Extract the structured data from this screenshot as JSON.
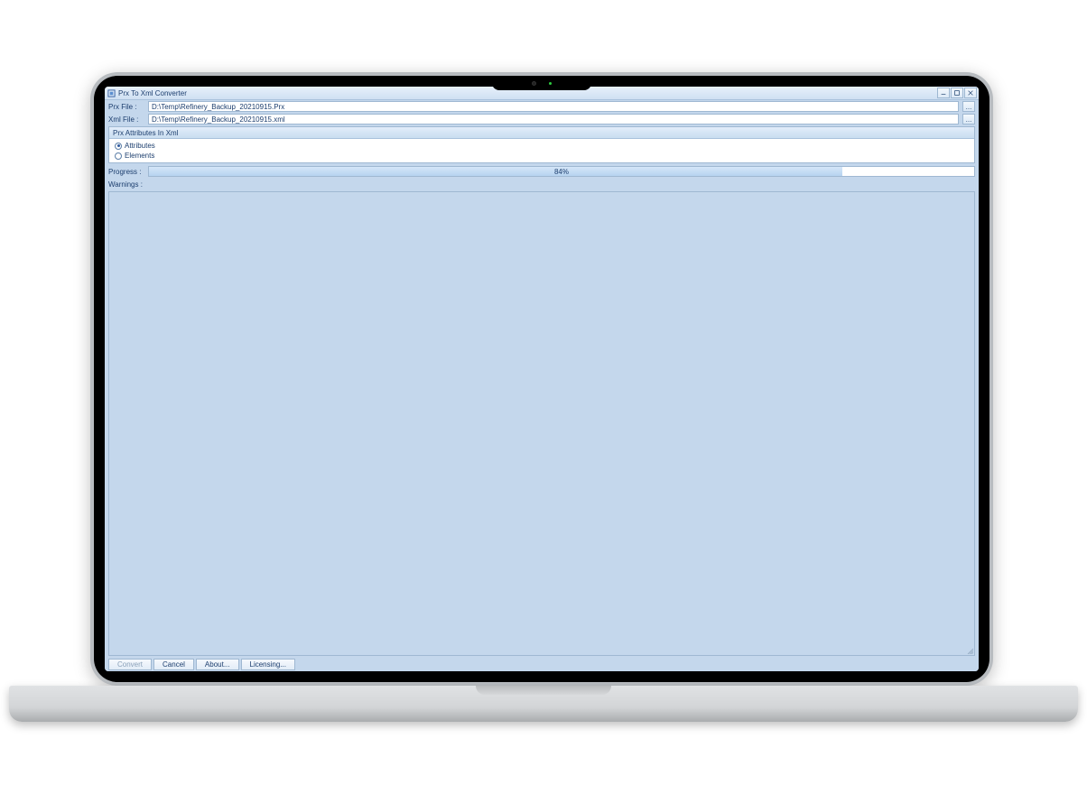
{
  "title": "Prx To Xml Converter",
  "prx_label": "Prx File :",
  "xml_label": "Xml File :",
  "prx_value": "D:\\Temp\\Refinery_Backup_20210915.Prx",
  "xml_value": "D:\\Temp\\Refinery_Backup_20210915.xml",
  "group_title": "Prx Attributes In Xml",
  "radio_attributes": "Attributes",
  "radio_elements": "Elements",
  "progress_label": "Progress :",
  "progress_percent": 84,
  "progress_text": "84%",
  "warnings_label": "Warnings :",
  "buttons": {
    "convert": "Convert",
    "cancel": "Cancel",
    "about": "About...",
    "licensing": "Licensing..."
  },
  "browse_glyph": "..."
}
